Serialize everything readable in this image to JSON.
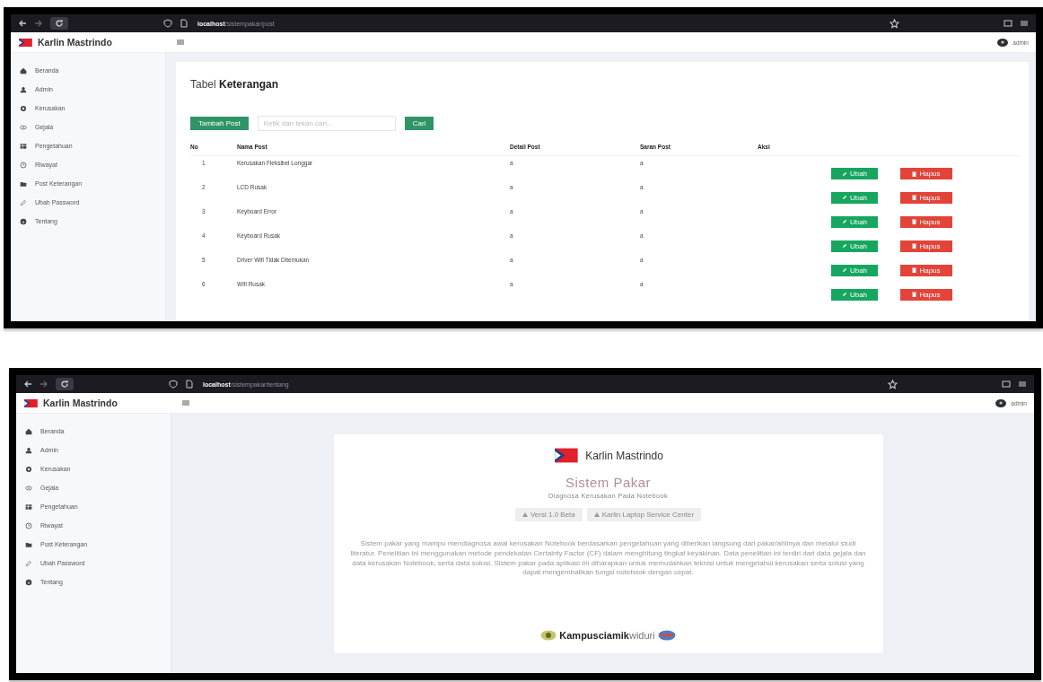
{
  "screens": [
    {
      "kind": "table",
      "browser": {
        "host": "localhost",
        "path": "/sistempakar/post"
      },
      "app": {
        "brand": "Karlin Mastrindo",
        "user": "admin",
        "menu": [
          {
            "label": "Beranda",
            "selected": false
          },
          {
            "label": "Admin",
            "selected": false
          },
          {
            "label": "Kerusakan",
            "selected": false
          },
          {
            "label": "Gejala",
            "selected": false
          },
          {
            "label": "Pengetahuan",
            "selected": false
          },
          {
            "label": "Riwayat",
            "selected": false
          },
          {
            "label": "Post Keterangan",
            "selected": false
          },
          {
            "label": "Ubah Password",
            "selected": false
          },
          {
            "label": "Tentang",
            "selected": false
          }
        ]
      },
      "page": {
        "title": "Tabel **Keterangan**",
        "add_button": "Tambah Post",
        "search": {
          "placeholder": "Ketik dan tekan cari..."
        },
        "search_button": "Cari",
        "table": {
          "columns": [
            "No",
            "Nama Post",
            "Detail Post",
            "Saran Post",
            "Aksi"
          ],
          "rows": [
            {
              "no": "1",
              "name": "Kerusakan Fleksibel Longgar",
              "detail": "a",
              "advice": "a",
              "edit": "Ubah",
              "delete": "Hapus"
            },
            {
              "no": "2",
              "name": "LCD Rusak",
              "detail": "a",
              "advice": "a",
              "edit": "Ubah",
              "delete": "Hapus"
            },
            {
              "no": "3",
              "name": "Keyboard Error",
              "detail": "a",
              "advice": "a",
              "edit": "Ubah",
              "delete": "Hapus"
            },
            {
              "no": "4",
              "name": "Keyboard Rusak",
              "detail": "a",
              "advice": "a",
              "edit": "Ubah",
              "delete": "Hapus"
            },
            {
              "no": "5",
              "name": "Driver Wifi Tidak Ditemukan",
              "detail": "a",
              "advice": "a",
              "edit": "Ubah",
              "delete": "Hapus"
            },
            {
              "no": "6",
              "name": "Wifi Rusak",
              "detail": "a",
              "advice": "a",
              "edit": "Ubah",
              "delete": "Hapus"
            }
          ]
        }
      }
    },
    {
      "kind": "about",
      "browser": {
        "host": "localhost",
        "path": "/sistempakar/tentang"
      },
      "app": {
        "brand": "Karlin Mastrindo",
        "user": "admin",
        "menu": [
          {
            "label": "Beranda",
            "selected": false
          },
          {
            "label": "Admin",
            "selected": false
          },
          {
            "label": "Kerusakan",
            "selected": false
          },
          {
            "label": "Gejala",
            "selected": false
          },
          {
            "label": "Pengetahuan",
            "selected": false
          },
          {
            "label": "Riwayat",
            "selected": false
          },
          {
            "label": "Post Keterangan",
            "selected": false
          },
          {
            "label": "Ubah Password",
            "selected": false
          },
          {
            "label": "Tentang",
            "selected": false
          }
        ]
      },
      "page": {
        "logo_text": "Karlin Mastrindo",
        "title": "Sistem Pakar",
        "subtitle": "Diagnosa Kerusakan Pada Notebook",
        "badges": [
          "Versi 1.0 Beta",
          "Karlin Laptop Service Center"
        ],
        "description": "Sistem pakar yang mampu mendiagnosa awal kerusakan Notebook berdasarkan pengetahuan yang diberikan langsung dari pakar/ahlinya dan melalui studi literatur. Penelitian ini menggunakan metode pendekatan Certainty Factor (CF) dalam menghitung tingkat keyakinan. Data penelitian ini terdiri dari data gejala dan data kerusakan Notebook, serta data solusi. Sistem pakar pada aplikasi ini diharapkan untuk memudahkan teknisi untuk mengetahui kerusakan serta solusi yang dapat mengembalikan fungsi notebook dengan cepat.",
        "footer_logo": "**Kampusciamik**widuri"
      }
    }
  ]
}
